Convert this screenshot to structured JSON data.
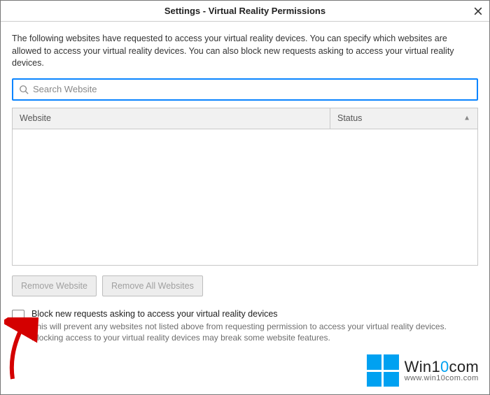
{
  "title": "Settings - Virtual Reality Permissions",
  "intro": "The following websites have requested to access your virtual reality devices. You can specify which websites are allowed to access your virtual reality devices. You can also block new requests asking to access your virtual reality devices.",
  "search": {
    "placeholder": "Search Website"
  },
  "columns": {
    "website": "Website",
    "status": "Status"
  },
  "buttons": {
    "remove": "Remove Website",
    "remove_all": "Remove All Websites"
  },
  "block_option": {
    "label": "Block new requests asking to access your virtual reality devices",
    "desc": "This will prevent any websites not listed above from requesting permission to access your virtual reality devices. Blocking access to your virtual reality devices may break some website features."
  },
  "watermark": {
    "brand_pre": "Win1",
    "brand_zero": "0",
    "brand_suf": "com",
    "url": "www.win10com.com"
  }
}
